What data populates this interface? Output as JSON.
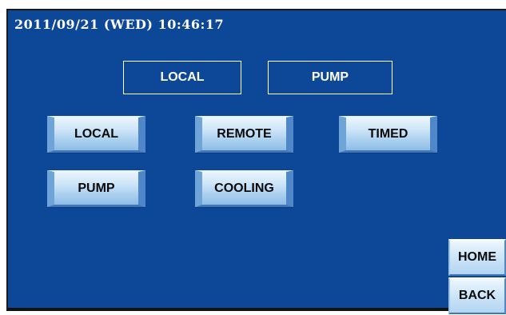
{
  "header": {
    "datetime": "2011/09/21 (WED) 10:46:17"
  },
  "status": {
    "mode": "LOCAL",
    "device": "PUMP"
  },
  "buttons": {
    "local": "LOCAL",
    "remote": "REMOTE",
    "timed": "TIMED",
    "pump": "PUMP",
    "cooling": "COOLING"
  },
  "nav": {
    "home": "HOME",
    "back": "BACK"
  },
  "colors": {
    "background": "#0d4798",
    "button_top": "#eaf5fd",
    "button_bottom": "#8fbde6",
    "text": "#ffffff"
  }
}
